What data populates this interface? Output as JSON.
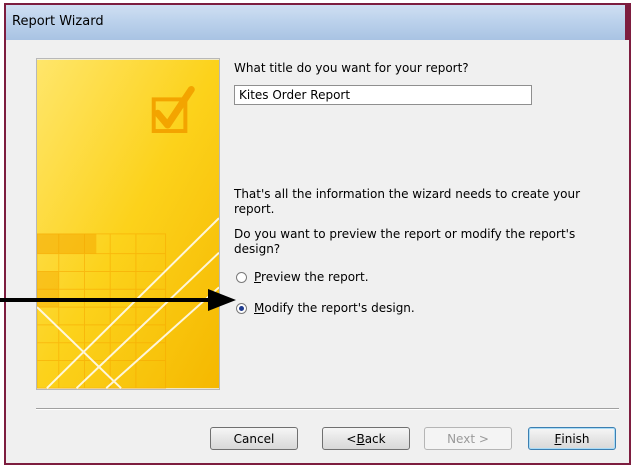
{
  "window": {
    "title": "Report Wizard"
  },
  "question": "What title do you want for your report?",
  "report_title_value": "Kites Order Report",
  "info_text": "That's all the information the wizard needs to create your report.",
  "preview_question": "Do you want to preview the report or modify the report's design?",
  "options": [
    {
      "label": "Preview the report.",
      "mnemonic": "P",
      "rest": "review the report.",
      "checked": false
    },
    {
      "label": "Modify the report's design.",
      "mnemonic": "M",
      "rest": "odify the report's design.",
      "checked": true
    }
  ],
  "buttons": {
    "cancel": "Cancel",
    "back_prefix": "< ",
    "back_mnemonic": "B",
    "back_rest": "ack",
    "next": "Next >",
    "finish_mnemonic": "F",
    "finish_rest": "inish"
  },
  "colors": {
    "accent_border": "#7d1d3f",
    "graphic_yellow": "#f7c600",
    "graphic_yellow_light": "#ffe66b",
    "graphic_orange": "#f4a800",
    "annotation_arrow": "#000000"
  },
  "icons": {
    "graphic": "wizard-checkmark-graphic",
    "pointer": "annotation-arrow"
  }
}
